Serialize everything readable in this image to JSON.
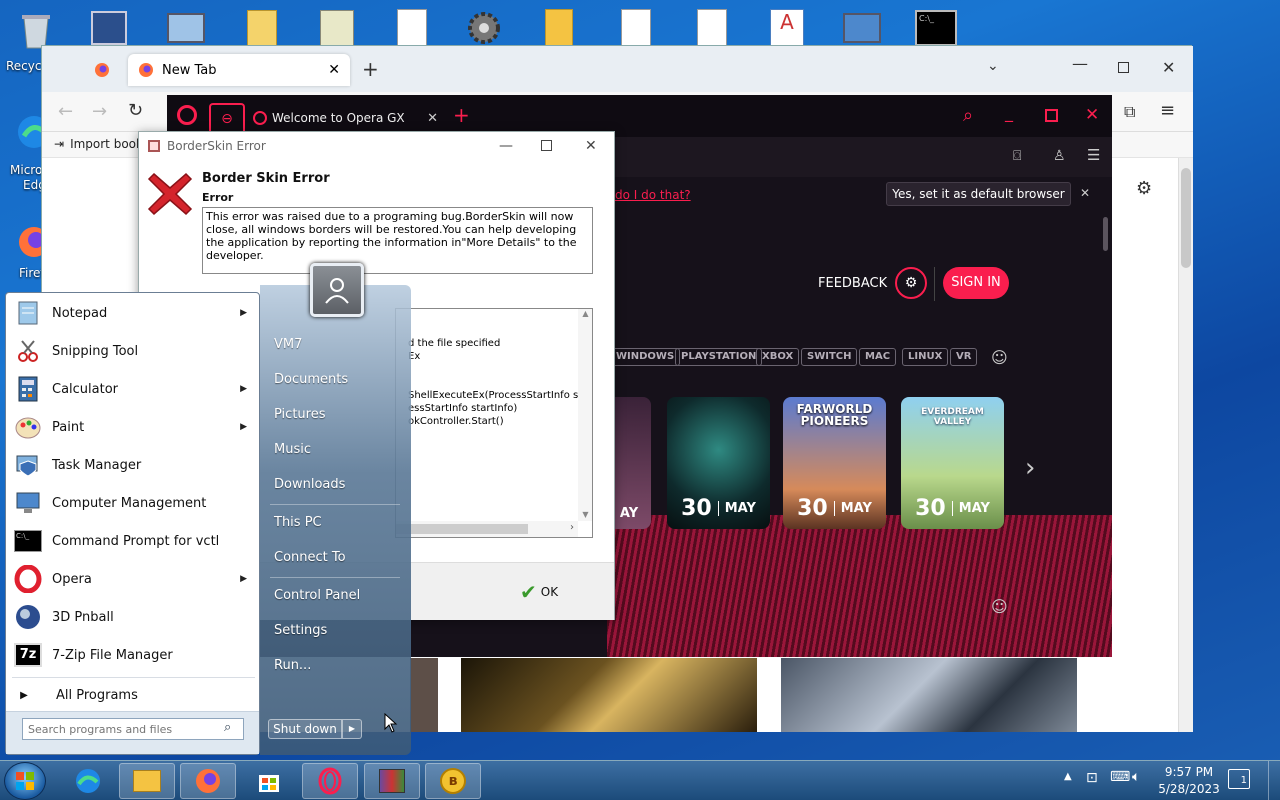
{
  "desktop": {
    "recycle_label": "Recycl",
    "edge_label": "Micro",
    "edge_label2": "Edg",
    "firefox_label": "Firef"
  },
  "browser": {
    "tab_active": "New Tab",
    "bookmarks": {
      "import": "Import book"
    }
  },
  "opera": {
    "tab_title": "Welcome to Opera GX",
    "default_prompt_link": "do I do that?",
    "default_button": "Yes, set it as default browser",
    "feedback": "FEEDBACK",
    "sign_in": "SIGN IN",
    "tags": [
      "WINDOWS",
      "PLAYSTATION",
      "XBOX",
      "SWITCH",
      "MAC",
      "LINUX",
      "VR"
    ],
    "cards": [
      {
        "day": "",
        "month": "AY"
      },
      {
        "day": "30",
        "month": "MAY"
      },
      {
        "day": "30",
        "month": "MAY",
        "title": "FARWORLD PIONEERS"
      },
      {
        "day": "30",
        "month": "MAY",
        "title": "EVERDREAM VALLEY"
      }
    ]
  },
  "dialog": {
    "title": "BorderSkin Error",
    "heading": "Border Skin Error",
    "subheading": "Error",
    "message": "This error was raised due to a programing bug.BorderSkin will now close, all windows borders will be restored.You can help developing the application by reporting the information in\"More Details\" to the developer.",
    "details_lines": [
      "d the file specified",
      "Ex",
      "",
      "",
      "ShellExecuteEx(ProcessStartInfo st",
      "essStartInfo startInfo)",
      "okController.Start()"
    ],
    "ok_label": "OK"
  },
  "start_menu": {
    "programs": [
      {
        "label": "Notepad",
        "arrow": true,
        "icon": "notepad-icon"
      },
      {
        "label": "Snipping Tool",
        "arrow": false,
        "icon": "snipping-tool-icon"
      },
      {
        "label": "Calculator",
        "arrow": true,
        "icon": "calculator-icon"
      },
      {
        "label": "Paint",
        "arrow": true,
        "icon": "paint-icon"
      },
      {
        "label": "Task Manager",
        "arrow": false,
        "icon": "task-manager-icon"
      },
      {
        "label": "Computer Management",
        "arrow": false,
        "icon": "computer-management-icon"
      },
      {
        "label": "Command Prompt for vctl",
        "arrow": false,
        "icon": "command-prompt-icon"
      },
      {
        "label": "Opera",
        "arrow": true,
        "icon": "opera-icon"
      },
      {
        "label": "3D Pnball",
        "arrow": false,
        "icon": "pinball-icon"
      },
      {
        "label": "7-Zip File Manager",
        "arrow": false,
        "icon": "7zip-icon"
      }
    ],
    "all_programs": "All Programs",
    "search_placeholder": "Search programs and files",
    "right_items": [
      "VM7",
      "Documents",
      "Pictures",
      "Music",
      "Downloads",
      "This PC",
      "Connect To",
      "Control Panel",
      "Settings",
      "Run..."
    ],
    "shutdown": "Shut down"
  },
  "taskbar": {
    "time": "9:57 PM",
    "date": "5/28/2023",
    "notification_count": "1"
  },
  "colors": {
    "opera_accent": "#fa1e4e",
    "taskbar": "#1c4b7a"
  }
}
